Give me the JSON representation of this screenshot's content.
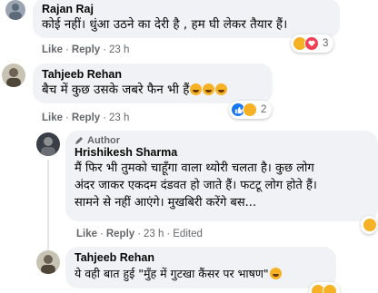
{
  "comments": [
    {
      "name": "Rajan Raj",
      "text": "कोई नहीं। धुंआ उठने का देरी है , हम घी लेकर तैयार हैं।",
      "like": "Like",
      "reply": "Reply",
      "time": "23 h",
      "reaction_count": "3"
    },
    {
      "name": "Tahjeeb Rehan",
      "text": "बैच में कुछ उसके जबरे फैन भी हैं",
      "like": "Like",
      "reply": "Reply",
      "time": "23 h",
      "reaction_count": "2"
    },
    {
      "badge": "Author",
      "name": "Hrishikesh Sharma",
      "text": "मैं फिर भी तुमको चाहूँगा वाला थ्योरी चलता है। कुछ लोग\nअंदर जाकर एकदम दंडवत हो जाते हैं। फटटू लोग होते हैं।\nसामने से नहीं आएंगे। मुखबिरी करेंगे बस...",
      "like": "Like",
      "reply": "Reply",
      "time": "23 h",
      "edited": "Edited"
    },
    {
      "name": "Tahjeeb Rehan",
      "text": "ये वही बात हुई \"मुँह में गुटखा कैंसर पर भाषण\""
    }
  ],
  "colors": {
    "bubble": "#f0f2f5",
    "meta": "#65676b",
    "haha": "#f7b125",
    "love": "#f33e58",
    "like": "#1877f2"
  }
}
